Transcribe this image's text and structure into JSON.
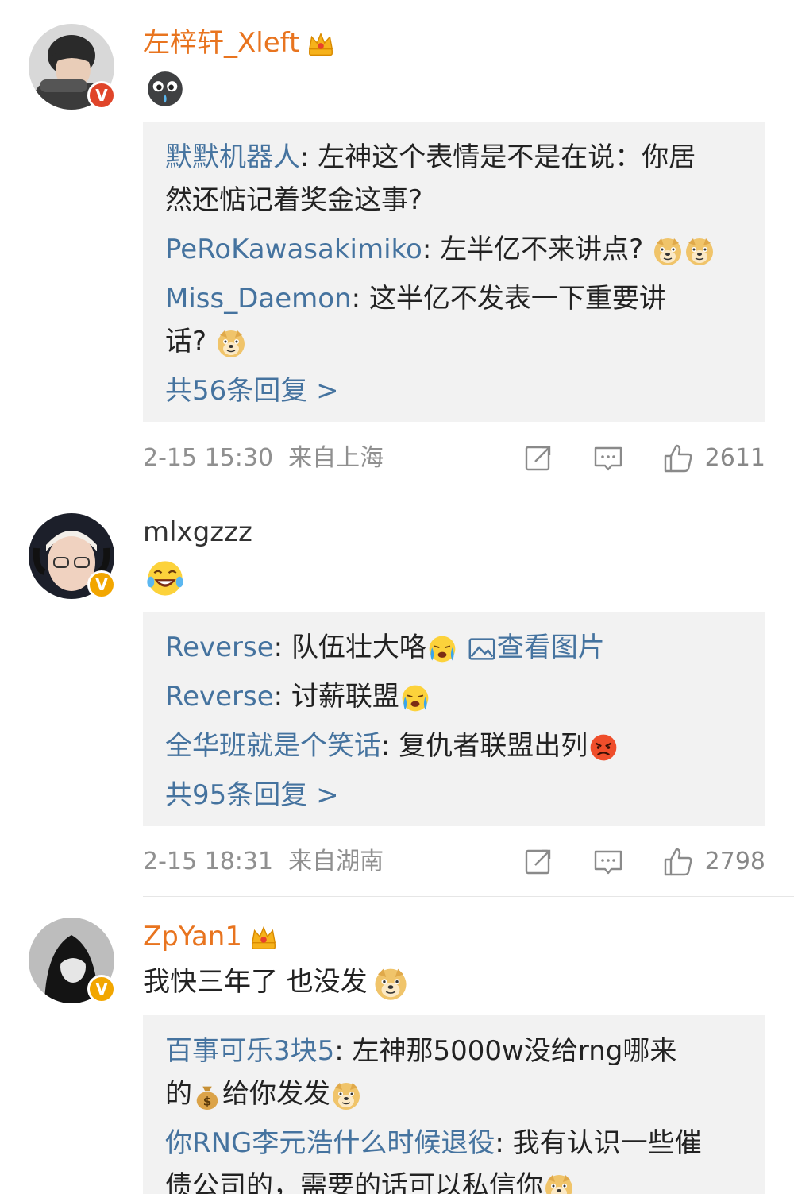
{
  "comments": [
    {
      "username": "左梓轩_Xleft",
      "avatar_icon": "avatar-photo",
      "verified_badge": "V",
      "badge_color": "#e0452a",
      "body_emoji": "crying-bomb-emoji",
      "replies": [
        {
          "author": "默默机器人",
          "sep": ": ",
          "text_line1": "左神这个表情是不是在说：你居",
          "text_line2": "然还惦记着奖金这事?"
        },
        {
          "author": "PeRoKawasakimiko",
          "sep": ": ",
          "text": "左半亿不来讲点?"
        },
        {
          "author": "Miss_Daemon",
          "sep": ": ",
          "text_line1": "这半亿不发表一下重要讲",
          "text_line2": "话?"
        }
      ],
      "more_replies": "共56条回复 >",
      "time": "2-15 15:30",
      "location": "来自上海",
      "likes": "2611"
    },
    {
      "username": "mlxgzzz",
      "avatar_icon": "avatar-photo",
      "verified_badge": "V",
      "badge_color": "#f2a600",
      "body_emoji": "laughing-tears-emoji",
      "replies": [
        {
          "author": "Reverse",
          "sep": ": ",
          "text": "队伍壮大咯",
          "link": "查看图片"
        },
        {
          "author": "Reverse",
          "sep": ": ",
          "text": "讨薪联盟"
        },
        {
          "author": "全华班就是个笑话",
          "sep": ": ",
          "text": "复仇者联盟出列"
        }
      ],
      "more_replies": "共95条回复 >",
      "time": "2-15 18:31",
      "location": "来自湖南",
      "likes": "2798"
    },
    {
      "username": "ZpYan1",
      "avatar_icon": "avatar-photo",
      "verified_badge": "V",
      "badge_color": "#f2a600",
      "body_text": "我快三年了 也没发",
      "replies": [
        {
          "author": "百事可乐3块5",
          "sep": ": ",
          "text_line1": "左神那5000w没给rng哪来",
          "text_line2a": "的",
          "text_line2b": "给你发发"
        },
        {
          "author": "你RNG李元浩什么时候退役",
          "sep": ": ",
          "text_line1": "我有认识一些催",
          "text_line2": "债公司的，需要的话可以私信你"
        }
      ]
    }
  ],
  "colors": {
    "link": "#45739f",
    "username_vip": "#e8741f",
    "reply_bg": "#f2f2f2",
    "meta_gray": "#909090"
  }
}
